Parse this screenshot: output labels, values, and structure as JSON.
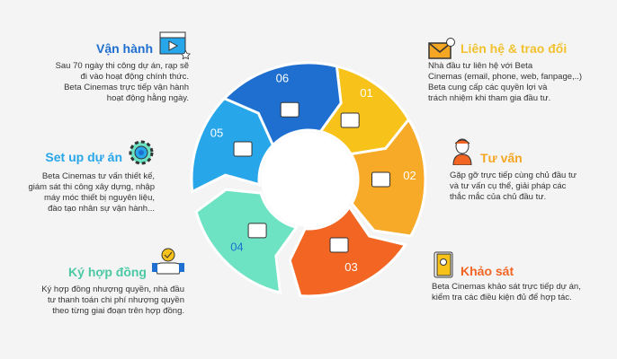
{
  "steps": [
    {
      "num": "01",
      "title": "Liên hệ & trao đổi",
      "color": "#f7c21a",
      "title_color": "#f2c12e",
      "icon": "envelope-icon",
      "desc": [
        "Nhà đầu tư liên hệ với Beta",
        "Cinemas (email, phone, web, fanpage,..)",
        "Beta cung cấp các quyền lợi và",
        "trách nhiệm khi tham gia đầu tư."
      ]
    },
    {
      "num": "02",
      "title": "Tư vấn",
      "color": "#f7a928",
      "title_color": "#f5a623",
      "icon": "consultant-headset-icon",
      "desc": [
        "Gặp gỡ trực tiếp cùng chủ đầu tư",
        "và tư vấn cụ thể, giải pháp các",
        "thắc mắc của chủ đầu tư."
      ]
    },
    {
      "num": "03",
      "title": "Khảo sát",
      "color": "#f26522",
      "title_color": "#f26522",
      "icon": "notebook-icon",
      "desc": [
        "Beta Cinemas khảo sát trực tiếp dự án,",
        "kiểm tra các điều kiện đủ để hợp tác."
      ]
    },
    {
      "num": "04",
      "title": "Ký hợp đồng",
      "color": "#6ee3c4",
      "title_color": "#4cc9a4",
      "icon": "handshake-icon",
      "desc": [
        "Ký hợp đồng nhượng quyền, nhà đầu",
        "tư thanh toán chi phí nhượng quyền",
        "theo từng giai đoạn trên hợp đồng."
      ]
    },
    {
      "num": "05",
      "title": "Set up dự án",
      "color": "#27a6ea",
      "title_color": "#27a6ea",
      "icon": "gear-icon",
      "desc": [
        "Beta Cinemas tư vấn thiết kế,",
        "giám sát thi công xây dựng, nhập",
        "máy móc thiết bị nguyên liệu,",
        "đào tạo nhân sự vận hành..."
      ]
    },
    {
      "num": "06",
      "title": "Vận hành",
      "color": "#1e6fd0",
      "title_color": "#1e6fd0",
      "icon": "video-play-icon",
      "desc": [
        "Sau 70 ngày thi công dự án, rạp sẽ",
        "đi vào hoạt động chính thức.",
        "Beta Cinemas trực tiếp vận hành",
        "hoạt động hằng ngày."
      ]
    }
  ]
}
